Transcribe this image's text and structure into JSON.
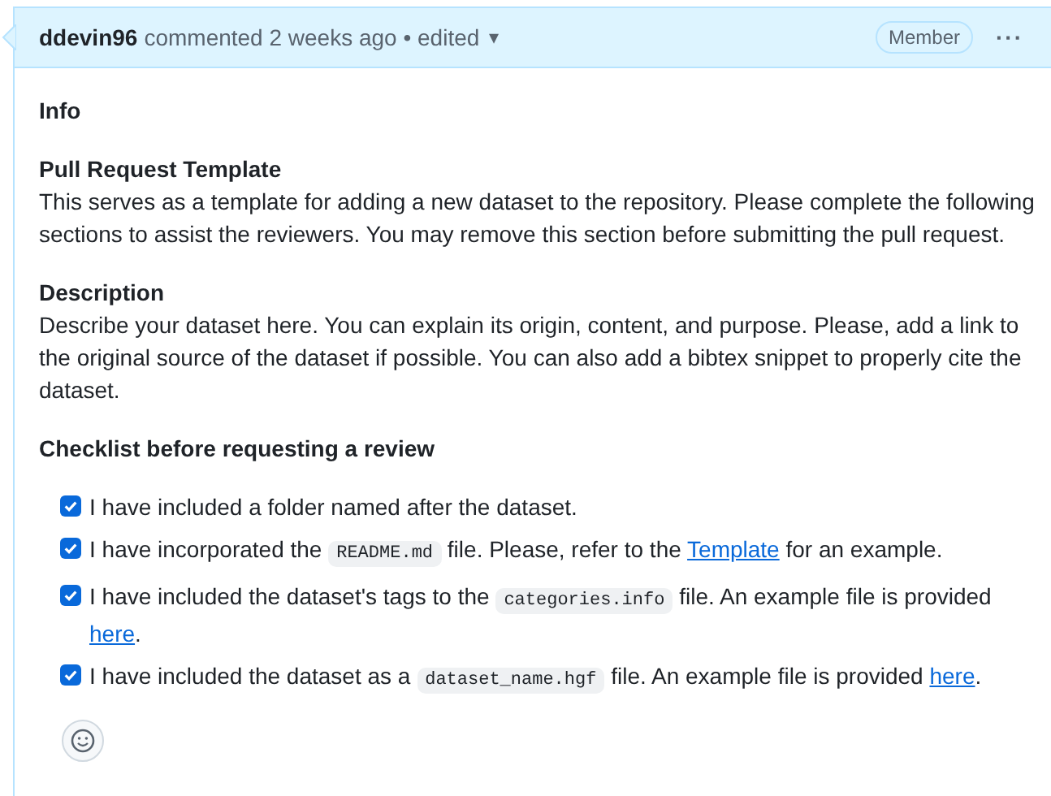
{
  "comment": {
    "author": "ddevin96",
    "meta": "commented 2 weeks ago • edited",
    "edit_menu_caret": "▾",
    "role_badge": "Member",
    "more_menu": "···"
  },
  "body": [
    {
      "kind": "heading",
      "text": "Info"
    },
    {
      "kind": "heading",
      "text": "Pull Request Template"
    },
    {
      "kind": "paragraph",
      "text": "This serves as a template for adding a new dataset to the repository. Please complete the following sections to assist the reviewers. You may remove this section before submitting the pull request."
    },
    {
      "kind": "heading",
      "text": "Description"
    },
    {
      "kind": "paragraph",
      "text": "Describe your dataset here. You can explain its origin, content, and purpose. Please, add a link to the original source of the dataset if possible. You can also add a bibtex snippet to properly cite the dataset."
    },
    {
      "kind": "heading",
      "text": "Checklist before requesting a review"
    }
  ],
  "checklist": [
    {
      "checked": true,
      "parts": [
        {
          "kind": "text",
          "text": "I have included a folder named after the dataset."
        }
      ]
    },
    {
      "checked": true,
      "parts": [
        {
          "kind": "text",
          "text": "I have incorporated the "
        },
        {
          "kind": "code",
          "text": "README.md"
        },
        {
          "kind": "text",
          "text": " file. Please, refer to the "
        },
        {
          "kind": "link",
          "text": "Template"
        },
        {
          "kind": "text",
          "text": " for an example."
        }
      ]
    },
    {
      "checked": true,
      "parts": [
        {
          "kind": "text",
          "text": "I have included the dataset's tags to the "
        },
        {
          "kind": "code",
          "text": "categories.info"
        },
        {
          "kind": "text",
          "text": " file. An example file is provided "
        },
        {
          "kind": "link",
          "text": "here"
        },
        {
          "kind": "text",
          "text": "."
        }
      ]
    },
    {
      "checked": true,
      "parts": [
        {
          "kind": "text",
          "text": "I have included the dataset as a "
        },
        {
          "kind": "code",
          "text": "dataset_name.hgf"
        },
        {
          "kind": "text",
          "text": " file. An example file is provided "
        },
        {
          "kind": "link",
          "text": "here"
        },
        {
          "kind": "text",
          "text": "."
        }
      ]
    }
  ]
}
